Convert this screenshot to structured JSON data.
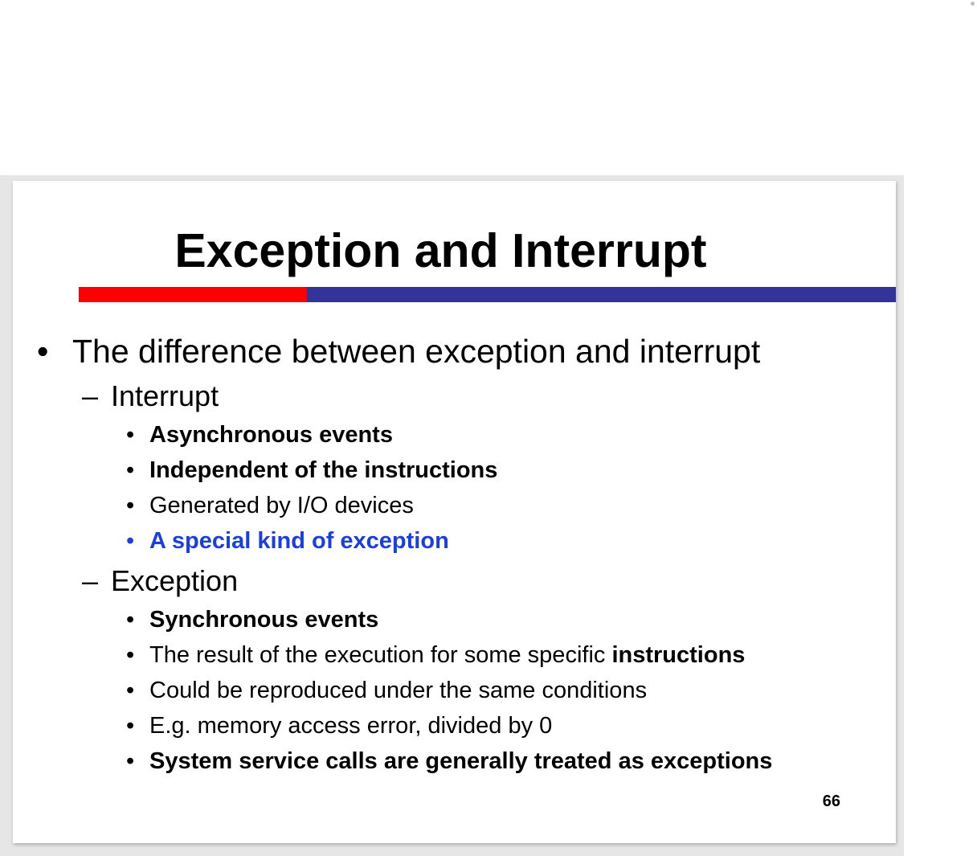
{
  "slide": {
    "title": "Exception and Interrupt",
    "page_number": "66",
    "bullet_glyph": "•",
    "dash_glyph": "–",
    "main_point": "The difference between exception and interrupt",
    "interrupt": {
      "heading": "Interrupt",
      "items": [
        "Asynchronous events",
        "Independent of the instructions",
        "Generated by I/O devices",
        "A special kind of exception"
      ]
    },
    "exception": {
      "heading": "Exception",
      "items": [
        "Synchronous events",
        "The result of the execution for some specific ",
        "Could be reproduced under the same conditions",
        "E.g. memory access error, divided by 0",
        "System service calls are generally treated as exceptions"
      ],
      "item_1_emphasis": "instructions"
    }
  },
  "colors": {
    "accent_red": "#ff0000",
    "accent_blue": "#333399",
    "highlight_text": "#1a3fe0"
  }
}
